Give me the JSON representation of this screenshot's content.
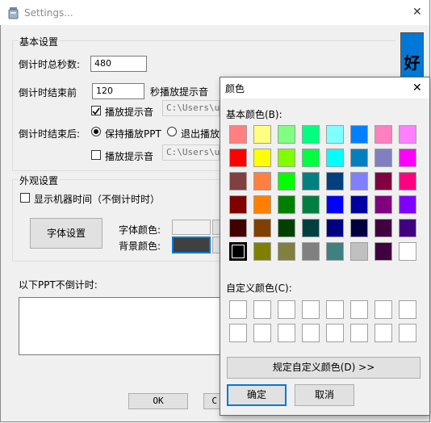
{
  "window": {
    "title": "Settings...",
    "close_glyph": "✕"
  },
  "basic": {
    "group_title": "基本设置",
    "total_seconds_label": "倒计时总秒数:",
    "total_seconds_value": "480",
    "before_end_label": "倒计时结束前",
    "before_end_value": "120",
    "before_end_suffix": "秒播放提示音",
    "play_sound_1_label": "播放提示音",
    "sound_path_1": "C:\\Users\\us",
    "after_end_label": "倒计时结束后:",
    "keep_playing_label": "保持播放PPT",
    "exit_playing_label": "退出播放",
    "play_sound_2_label": "播放提示音",
    "sound_path_2": "C:\\Users\\us"
  },
  "appearance": {
    "group_title": "外观设置",
    "show_time_label": "显示机器时间（不倒计时时）",
    "font_button": "字体设置",
    "font_color_label": "字体颜色:",
    "bg_color_label": "背景颜色:",
    "font_color": "#f0f0f0",
    "bg_color": "#404040"
  },
  "ppt_list": {
    "label": "以下PPT不倒计时:"
  },
  "buttons": {
    "ok": "OK",
    "cancel_partial": "C"
  },
  "preview": {
    "text": "好",
    "bg": "#0078d7"
  },
  "color_dialog": {
    "title": "颜色",
    "close_glyph": "✕",
    "basic_label": "基本颜色(B):",
    "custom_label": "自定义颜色(C):",
    "define_button": "规定自定义颜色(D) >>",
    "ok_button": "确定",
    "cancel_button": "取消",
    "basic_colors": [
      [
        "#ff8080",
        "#ffff80",
        "#80ff80",
        "#00ff80",
        "#80ffff",
        "#0080ff",
        "#ff80c0",
        "#ff80ff"
      ],
      [
        "#ff0000",
        "#ffff00",
        "#80ff00",
        "#00ff40",
        "#00ffff",
        "#0080c0",
        "#8080c0",
        "#ff00ff"
      ],
      [
        "#804040",
        "#ff8040",
        "#00ff00",
        "#008080",
        "#004080",
        "#8080ff",
        "#800040",
        "#ff0080"
      ],
      [
        "#800000",
        "#ff8000",
        "#008000",
        "#008040",
        "#0000ff",
        "#0000a0",
        "#800080",
        "#8000ff"
      ],
      [
        "#400000",
        "#804000",
        "#004000",
        "#004040",
        "#000080",
        "#000040",
        "#400040",
        "#400080"
      ],
      [
        "#000000",
        "#808000",
        "#808040",
        "#808080",
        "#408080",
        "#c0c0c0",
        "#400040",
        "#ffffff"
      ]
    ],
    "selected": "#000000"
  }
}
